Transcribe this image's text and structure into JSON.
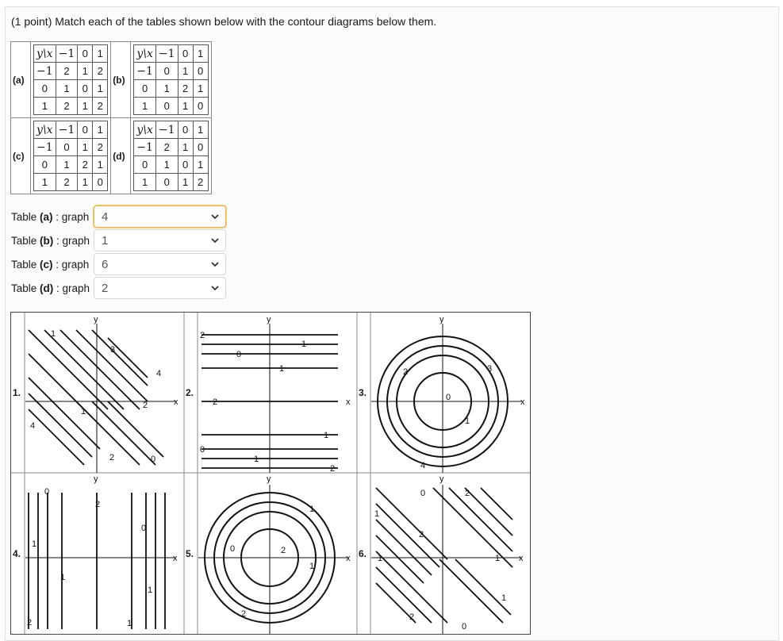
{
  "prompt": "(1 point) Match each of the tables shown below with the contour diagrams below them.",
  "tables": [
    {
      "label": "(a)",
      "header": [
        "y\\x",
        "−1",
        "0",
        "1"
      ],
      "rows": [
        [
          "−1",
          "2",
          "1",
          "2"
        ],
        [
          "0",
          "1",
          "0",
          "1"
        ],
        [
          "1",
          "2",
          "1",
          "2"
        ]
      ]
    },
    {
      "label": "(b)",
      "header": [
        "y\\x",
        "−1",
        "0",
        "1"
      ],
      "rows": [
        [
          "−1",
          "0",
          "1",
          "0"
        ],
        [
          "0",
          "1",
          "2",
          "1"
        ],
        [
          "1",
          "0",
          "1",
          "0"
        ]
      ]
    },
    {
      "label": "(c)",
      "header": [
        "y\\x",
        "−1",
        "0",
        "1"
      ],
      "rows": [
        [
          "−1",
          "0",
          "1",
          "2"
        ],
        [
          "0",
          "1",
          "2",
          "1"
        ],
        [
          "1",
          "2",
          "1",
          "0"
        ]
      ]
    },
    {
      "label": "(d)",
      "header": [
        "y\\x",
        "−1",
        "0",
        "1"
      ],
      "rows": [
        [
          "−1",
          "2",
          "1",
          "0"
        ],
        [
          "0",
          "1",
          "0",
          "1"
        ],
        [
          "1",
          "0",
          "1",
          "2"
        ]
      ]
    }
  ],
  "answers": [
    {
      "prefix": "Table ",
      "bold": "(a)",
      "suffix": " : graph",
      "value": "4",
      "focused": true
    },
    {
      "prefix": "Table ",
      "bold": "(b)",
      "suffix": " : graph",
      "value": "1",
      "focused": false
    },
    {
      "prefix": "Table ",
      "bold": "(c)",
      "suffix": " : graph",
      "value": "6",
      "focused": false
    },
    {
      "prefix": "Table ",
      "bold": "(d)",
      "suffix": " : graph",
      "value": "2",
      "focused": false
    }
  ],
  "graphs": [
    {
      "num": "1.",
      "axis_x": "x",
      "axis_y": "y"
    },
    {
      "num": "2.",
      "axis_x": "x",
      "axis_y": "y"
    },
    {
      "num": "3.",
      "axis_x": "x",
      "axis_y": "y"
    },
    {
      "num": "4.",
      "axis_x": "x",
      "axis_y": "y"
    },
    {
      "num": "5.",
      "axis_x": "x",
      "axis_y": "y"
    },
    {
      "num": "6.",
      "axis_x": "x",
      "axis_y": "y"
    }
  ],
  "contour_labels": {
    "g1": [
      "1",
      "3",
      "4",
      "2",
      "1",
      "4",
      "2",
      "0"
    ],
    "g2": [
      "2",
      "1",
      "0",
      "1",
      "2",
      "1",
      "0",
      "1",
      "2"
    ],
    "g3": [
      "2",
      "3",
      "0",
      "1",
      "4"
    ],
    "g4": [
      "0",
      "2",
      "0",
      "1",
      "1",
      "1",
      "2",
      "1"
    ],
    "g5": [
      "1",
      "0",
      "2",
      "1",
      "2"
    ],
    "g6": [
      "0",
      "2",
      "1",
      "2",
      "1",
      "1",
      "1",
      "2",
      "0"
    ]
  },
  "colors": {
    "focus": "#f0b450",
    "border": "#d7d7d7",
    "ink": "#111111"
  }
}
